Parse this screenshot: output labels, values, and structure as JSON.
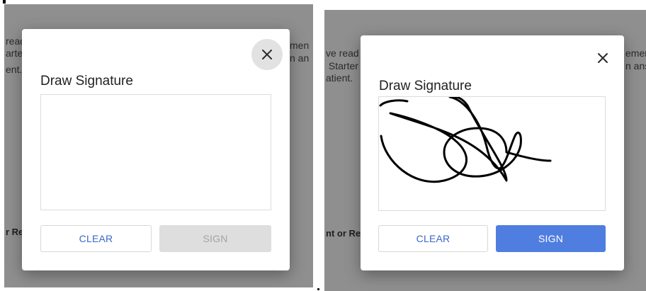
{
  "left": {
    "background": {
      "lines": [
        "read",
        "arter",
        "ent."
      ],
      "right_lines": [
        "men",
        "n an"
      ],
      "bold_text": "r Re"
    },
    "dialog": {
      "title": "Draw Signature",
      "close_label": "×",
      "clear_label": "CLEAR",
      "sign_label": "SIGN",
      "sign_enabled": false,
      "signature_drawn": false
    }
  },
  "right": {
    "background": {
      "lines": [
        "ve read",
        " Starter",
        "atient."
      ],
      "right_lines": [
        "emen",
        "n ans"
      ],
      "bold_text": "nt or Re"
    },
    "dialog": {
      "title": "Draw Signature",
      "close_label": "×",
      "clear_label": "CLEAR",
      "sign_label": "SIGN",
      "sign_enabled": true,
      "signature_drawn": true
    }
  },
  "colors": {
    "accent": "#4f7ee0",
    "clear_text": "#3b67c9",
    "disabled_bg": "#dedede",
    "disabled_text": "#a3a3a3",
    "overlay": "#8f8f8f"
  }
}
